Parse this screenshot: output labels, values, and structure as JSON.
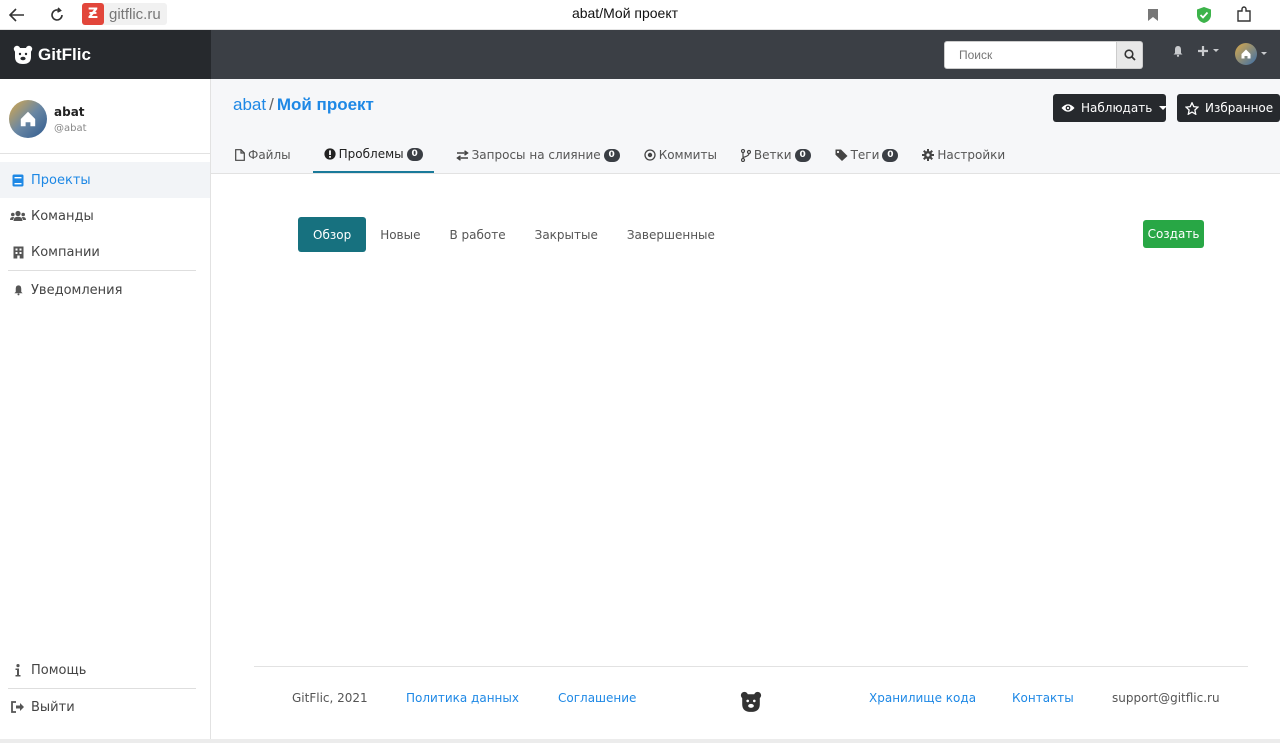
{
  "browser": {
    "url": "gitflic.ru",
    "tab_title": "abat/Мой проект"
  },
  "navbar": {
    "brand": "GitFlic",
    "search_placeholder": "Поиск"
  },
  "sidebar": {
    "user_name": "abat",
    "user_handle": "@abat",
    "items": [
      {
        "label": "Проекты",
        "icon": "book-icon"
      },
      {
        "label": "Команды",
        "icon": "users-icon"
      },
      {
        "label": "Компании",
        "icon": "building-icon"
      },
      {
        "label": "Уведомления",
        "icon": "bell-icon"
      }
    ],
    "bottom": [
      {
        "label": "Помощь",
        "icon": "info-icon"
      },
      {
        "label": "Выйти",
        "icon": "sign-out-icon"
      }
    ]
  },
  "header": {
    "owner": "abat",
    "separator": "/",
    "project": "Мой проект",
    "watch_label": "Наблюдать",
    "favorite_label": "Избранное"
  },
  "tabs": [
    {
      "label": "Файлы",
      "icon": "file-icon"
    },
    {
      "label": "Проблемы",
      "icon": "exclamation-icon",
      "count": "0"
    },
    {
      "label": "Запросы на слияние",
      "icon": "exchange-icon",
      "count": "0"
    },
    {
      "label": "Коммиты",
      "icon": "commit-icon"
    },
    {
      "label": "Ветки",
      "icon": "branch-icon",
      "count": "0"
    },
    {
      "label": "Теги",
      "icon": "tag-icon",
      "count": "0"
    },
    {
      "label": "Настройки",
      "icon": "gear-icon"
    }
  ],
  "issues_nav": {
    "items": [
      "Обзор",
      "Новые",
      "В работе",
      "Закрытые",
      "Завершенные"
    ],
    "create_label": "Создать"
  },
  "footer": {
    "copyright": "GitFlic, 2021",
    "privacy": "Политика данных",
    "agreement": "Соглашение",
    "storage": "Хранилище кода",
    "contacts": "Контакты",
    "email": "support@gitflic.ru"
  },
  "colors": {
    "accent": "#1e88e5",
    "navbar": "#3b3f45",
    "active_subnav": "#17717f",
    "create": "#28a745"
  }
}
